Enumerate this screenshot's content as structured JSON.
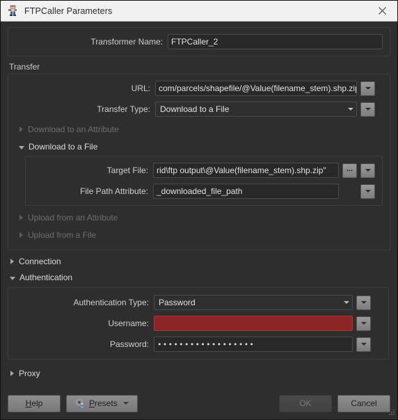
{
  "window": {
    "title": "FTPCaller Parameters",
    "icon": "fme-transformer-icon",
    "close_icon": "close-icon"
  },
  "transformer_name": {
    "label": "Transformer Name:",
    "value": "FTPCaller_2"
  },
  "transfer": {
    "group_label": "Transfer",
    "url": {
      "label": "URL:",
      "value": "com/parcels/shapefile/@Value(filename_stem).shp.zip"
    },
    "transfer_type": {
      "label": "Transfer Type:",
      "value": "Download to a File"
    },
    "download_attribute": {
      "label": "Download to an Attribute",
      "expanded": false,
      "enabled": false
    },
    "download_file": {
      "label": "Download to a File",
      "expanded": true,
      "target_file": {
        "label": "Target File:",
        "value": "rid\\ftp output\\@Value(filename_stem).shp.zip\"",
        "browse_label": "..."
      },
      "file_path_attribute": {
        "label": "File Path Attribute:",
        "value": "_downloaded_file_path"
      }
    },
    "upload_attribute": {
      "label": "Upload from an Attribute",
      "expanded": false,
      "enabled": false
    },
    "upload_file": {
      "label": "Upload from a File",
      "expanded": false,
      "enabled": false
    }
  },
  "connection": {
    "label": "Connection",
    "expanded": false
  },
  "authentication": {
    "label": "Authentication",
    "expanded": true,
    "auth_type": {
      "label": "Authentication Type:",
      "value": "Password"
    },
    "username": {
      "label": "Username:",
      "value": "",
      "error": true
    },
    "password": {
      "label": "Password:",
      "value": "••••••••••••••••••"
    }
  },
  "proxy": {
    "label": "Proxy",
    "expanded": false
  },
  "footer": {
    "help_label": "Help",
    "presets_label": "Presets",
    "ok_label": "OK",
    "cancel_label": "Cancel",
    "ok_enabled": false
  },
  "colors": {
    "dialog_bg": "#2e2e2e",
    "titlebar_bg": "#f1f1f1",
    "field_bg": "#282828",
    "error_red": "#8d2525",
    "border": "#4a4a4a"
  }
}
